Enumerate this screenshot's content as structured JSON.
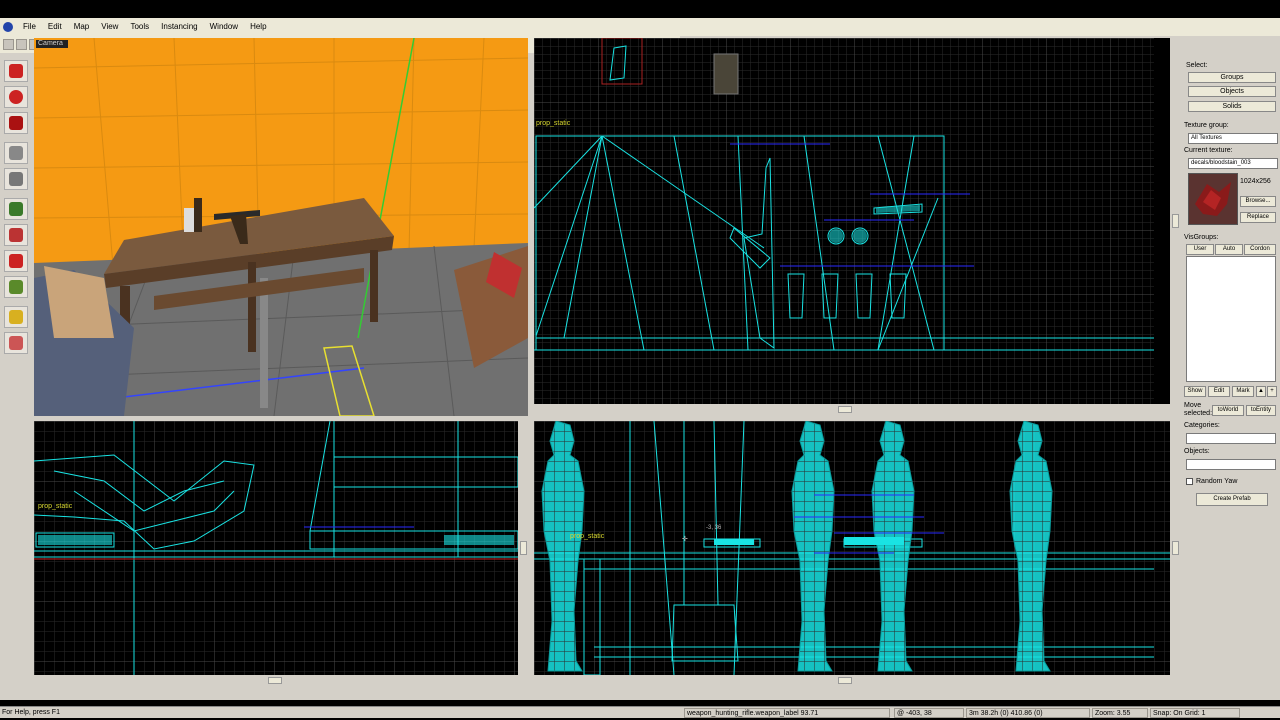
{
  "menu": [
    "File",
    "Edit",
    "Map",
    "View",
    "Tools",
    "Instancing",
    "Window",
    "Help"
  ],
  "viewports": {
    "camera_label": "Camera",
    "entity_label_top": "prop_static",
    "entity_label_side": "prop_static",
    "entity_label_front": "prop_static"
  },
  "panel": {
    "select_label": "Select:",
    "groups_btn": "Groups",
    "objects_btn": "Objects",
    "solids_btn": "Solids",
    "texture_group_label": "Texture group:",
    "texture_group_value": "All Textures",
    "current_texture_label": "Current texture:",
    "current_texture_value": "decals/bloodstain_003",
    "texture_size": "1024x256",
    "browse_btn": "Browse...",
    "replace_btn": "Replace",
    "visgroups_label": "VisGroups:",
    "tab_user": "User",
    "tab_auto": "Auto",
    "tab_cordon": "Cordon",
    "show_btn": "Show",
    "edit_btn": "Edit",
    "mark_btn": "Mark",
    "move_selected_label": "Move selected:",
    "to_world_btn": "toWorld",
    "to_entity_btn": "toEntity",
    "categories_label": "Categories:",
    "objects_label": "Objects:",
    "random_yaw_label": "Random Yaw",
    "create_prefab_btn": "Create Prefab"
  },
  "status": {
    "help": "For Help, press F1",
    "selection": "weapon_hunting_rifle.weapon_label 93.71",
    "coords": "@ -403, 38",
    "size": "3m 38.2h (0) 410.86 (0)",
    "zoom": "Zoom: 3.55",
    "snap": "Snap: On Grid: 1"
  },
  "colors": {
    "wire": "#19e3e3",
    "orange_wall": "#f59a13",
    "grid": "#3a3a3a",
    "blue_label": "#2a2aff"
  }
}
